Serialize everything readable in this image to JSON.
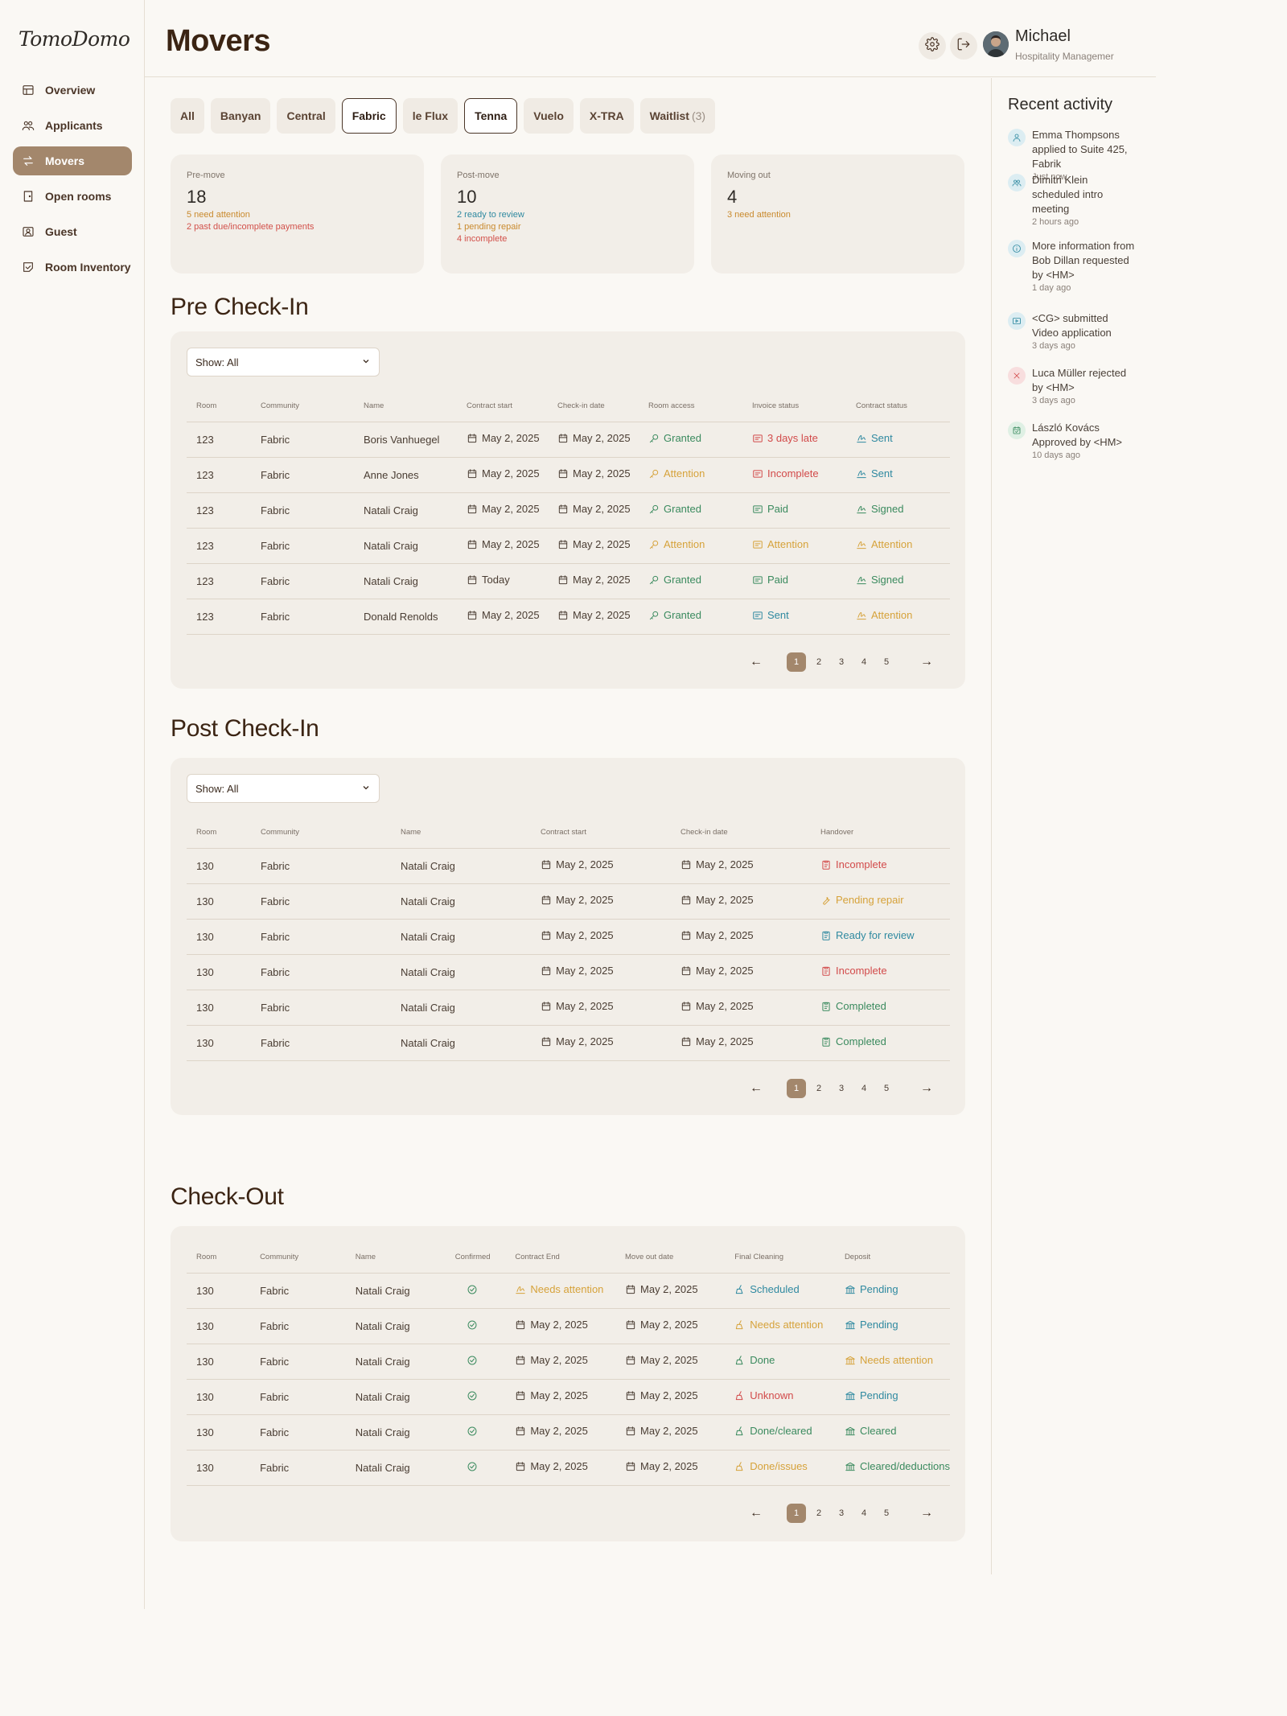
{
  "app": {
    "logo": "TomoDomo"
  },
  "sidebar": {
    "items": [
      {
        "label": "Overview",
        "icon": "overview-icon"
      },
      {
        "label": "Applicants",
        "icon": "applicants-icon"
      },
      {
        "label": "Movers",
        "icon": "movers-icon",
        "active": true
      },
      {
        "label": "Open rooms",
        "icon": "door-icon"
      },
      {
        "label": "Guest",
        "icon": "guest-icon"
      },
      {
        "label": "Room Inventory",
        "icon": "inventory-icon"
      }
    ]
  },
  "header": {
    "title": "Movers",
    "user_name": "Michael",
    "user_role": "Hospitality Managemer"
  },
  "tabs": [
    {
      "label": "All"
    },
    {
      "label": "Banyan"
    },
    {
      "label": "Central"
    },
    {
      "label": "Fabric",
      "selected": true
    },
    {
      "label": "le Flux"
    },
    {
      "label": "Tenna",
      "selected": true
    },
    {
      "label": "Vuelo"
    },
    {
      "label": "X-TRA"
    },
    {
      "label": "Waitlist",
      "count": "(3)"
    }
  ],
  "stats": [
    {
      "label": "Pre-move",
      "value": "18",
      "lines": [
        {
          "text": "5 need attention",
          "color": "#c98a2e"
        },
        {
          "text": "2 past due/incomplete payments",
          "color": "#d2504a"
        }
      ]
    },
    {
      "label": "Post-move",
      "value": "10",
      "lines": [
        {
          "text": "2 ready to review",
          "color": "#2f89a0"
        },
        {
          "text": "1 pending repair",
          "color": "#c98a2e"
        },
        {
          "text": "4 incomplete",
          "color": "#d2504a"
        }
      ]
    },
    {
      "label": "Moving out",
      "value": "4",
      "lines": [
        {
          "text": "3 need attention",
          "color": "#c98a2e"
        }
      ]
    }
  ],
  "pre_checkin": {
    "title": "Pre Check-In",
    "filter": "Show: All",
    "columns": [
      "Room",
      "Community",
      "Name",
      "Contract start",
      "Check-in date",
      "Room access",
      "Invoice status",
      "Contract status"
    ],
    "rows": [
      {
        "room": "123",
        "community": "Fabric",
        "name": "Boris Vanhuegel",
        "contract_start": "May 2, 2025",
        "checkin": "May 2, 2025",
        "access": "Granted",
        "access_c": "green",
        "invoice": "3 days late",
        "invoice_c": "red",
        "contract": "Sent",
        "contract_c": "teal"
      },
      {
        "room": "123",
        "community": "Fabric",
        "name": "Anne Jones",
        "contract_start": "May 2, 2025",
        "checkin": "May 2, 2025",
        "access": "Attention",
        "access_c": "amber",
        "invoice": "Incomplete",
        "invoice_c": "red",
        "contract": "Sent",
        "contract_c": "teal"
      },
      {
        "room": "123",
        "community": "Fabric",
        "name": "Natali Craig",
        "contract_start": "May 2, 2025",
        "checkin": "May 2, 2025",
        "access": "Granted",
        "access_c": "green",
        "invoice": "Paid",
        "invoice_c": "green",
        "contract": "Signed",
        "contract_c": "green"
      },
      {
        "room": "123",
        "community": "Fabric",
        "name": "Natali Craig",
        "contract_start": "May 2, 2025",
        "checkin": "May 2, 2025",
        "access": "Attention",
        "access_c": "amber",
        "invoice": "Attention",
        "invoice_c": "amber",
        "contract": "Attention",
        "contract_c": "amber"
      },
      {
        "room": "123",
        "community": "Fabric",
        "name": "Natali Craig",
        "contract_start": "Today",
        "checkin": "May 2, 2025",
        "access": "Granted",
        "access_c": "green",
        "invoice": "Paid",
        "invoice_c": "green",
        "contract": "Signed",
        "contract_c": "green"
      },
      {
        "room": "123",
        "community": "Fabric",
        "name": "Donald Renolds",
        "contract_start": "May 2, 2025",
        "checkin": "May 2, 2025",
        "access": "Granted",
        "access_c": "green",
        "invoice": "Sent",
        "invoice_c": "teal",
        "contract": "Attention",
        "contract_c": "amber"
      }
    ],
    "pages": [
      "1",
      "2",
      "3",
      "4",
      "5"
    ]
  },
  "post_checkin": {
    "title": "Post Check-In",
    "filter": "Show: All",
    "columns": [
      "Room",
      "Community",
      "Name",
      "Contract start",
      "Check-in date",
      "Handover"
    ],
    "rows": [
      {
        "room": "130",
        "community": "Fabric",
        "name": "Natali Craig",
        "contract_start": "May 2, 2025",
        "checkin": "May 2, 2025",
        "handover": "Incomplete",
        "handover_c": "red",
        "handover_icon": "clipboard-icon"
      },
      {
        "room": "130",
        "community": "Fabric",
        "name": "Natali Craig",
        "contract_start": "May 2, 2025",
        "checkin": "May 2, 2025",
        "handover": "Pending repair",
        "handover_c": "amber",
        "handover_icon": "wrench-icon"
      },
      {
        "room": "130",
        "community": "Fabric",
        "name": "Natali Craig",
        "contract_start": "May 2, 2025",
        "checkin": "May 2, 2025",
        "handover": "Ready for review",
        "handover_c": "teal",
        "handover_icon": "clipboard-icon"
      },
      {
        "room": "130",
        "community": "Fabric",
        "name": "Natali Craig",
        "contract_start": "May 2, 2025",
        "checkin": "May 2, 2025",
        "handover": "Incomplete",
        "handover_c": "red",
        "handover_icon": "clipboard-icon"
      },
      {
        "room": "130",
        "community": "Fabric",
        "name": "Natali Craig",
        "contract_start": "May 2, 2025",
        "checkin": "May 2, 2025",
        "handover": "Completed",
        "handover_c": "green",
        "handover_icon": "clipboard-icon"
      },
      {
        "room": "130",
        "community": "Fabric",
        "name": "Natali Craig",
        "contract_start": "May 2, 2025",
        "checkin": "May 2, 2025",
        "handover": "Completed",
        "handover_c": "green",
        "handover_icon": "clipboard-icon"
      }
    ],
    "pages": [
      "1",
      "2",
      "3",
      "4",
      "5"
    ]
  },
  "checkout": {
    "title": "Check-Out",
    "columns": [
      "Room",
      "Community",
      "Name",
      "Confirmed",
      "Contract End",
      "Move out date",
      "Final Cleaning",
      "Deposit"
    ],
    "rows": [
      {
        "room": "130",
        "community": "Fabric",
        "name": "Natali Craig",
        "contract_end": "Needs attention",
        "contract_end_c": "amber",
        "moveout": "May 2, 2025",
        "cleaning": "Scheduled",
        "cleaning_c": "teal",
        "deposit": "Pending",
        "deposit_c": "teal"
      },
      {
        "room": "130",
        "community": "Fabric",
        "name": "Natali Craig",
        "contract_end": "May 2, 2025",
        "contract_end_c": "",
        "moveout": "May 2, 2025",
        "cleaning": "Needs attention",
        "cleaning_c": "amber",
        "deposit": "Pending",
        "deposit_c": "teal"
      },
      {
        "room": "130",
        "community": "Fabric",
        "name": "Natali Craig",
        "contract_end": "May 2, 2025",
        "contract_end_c": "",
        "moveout": "May 2, 2025",
        "cleaning": "Done",
        "cleaning_c": "green",
        "deposit": "Needs attention",
        "deposit_c": "amber"
      },
      {
        "room": "130",
        "community": "Fabric",
        "name": "Natali Craig",
        "contract_end": "May 2, 2025",
        "contract_end_c": "",
        "moveout": "May 2, 2025",
        "cleaning": "Unknown",
        "cleaning_c": "red",
        "deposit": "Pending",
        "deposit_c": "teal"
      },
      {
        "room": "130",
        "community": "Fabric",
        "name": "Natali Craig",
        "contract_end": "May 2, 2025",
        "contract_end_c": "",
        "moveout": "May 2, 2025",
        "cleaning": "Done/cleared",
        "cleaning_c": "green",
        "deposit": "Cleared",
        "deposit_c": "green"
      },
      {
        "room": "130",
        "community": "Fabric",
        "name": "Natali Craig",
        "contract_end": "May 2, 2025",
        "contract_end_c": "",
        "moveout": "May 2, 2025",
        "cleaning": "Done/issues",
        "cleaning_c": "amber",
        "deposit": "Cleared/deductions",
        "deposit_c": "green"
      }
    ],
    "pages": [
      "1",
      "2",
      "3",
      "4",
      "5"
    ]
  },
  "activity": {
    "title": "Recent activity",
    "items": [
      {
        "text": "Emma Thompsons applied to Suite 425, Fabrik",
        "time": "Just now",
        "icon": "user-icon",
        "bg": "#dcedf2",
        "fg": "#2f89a0"
      },
      {
        "text": "Dimitri Klein scheduled intro meeting",
        "time": "2 hours ago",
        "icon": "users-icon",
        "bg": "#dcedf2",
        "fg": "#2f89a0"
      },
      {
        "text": "More information from Bob Dillan requested by <HM>",
        "time": "1 day ago",
        "icon": "info-icon",
        "bg": "#dcedf2",
        "fg": "#2f89a0"
      },
      {
        "text": "<CG> submitted Video application",
        "time": "3 days ago",
        "icon": "video-icon",
        "bg": "#dcedf2",
        "fg": "#2f89a0"
      },
      {
        "text": "Luca Müller rejected by <HM>",
        "time": "3 days ago",
        "icon": "x-icon",
        "bg": "#f8dede",
        "fg": "#d24a4a"
      },
      {
        "text": "László Kovács Approved by <HM>",
        "time": "10 days ago",
        "icon": "calendar-check-icon",
        "bg": "#dff0e4",
        "fg": "#3a8a5e"
      }
    ]
  }
}
